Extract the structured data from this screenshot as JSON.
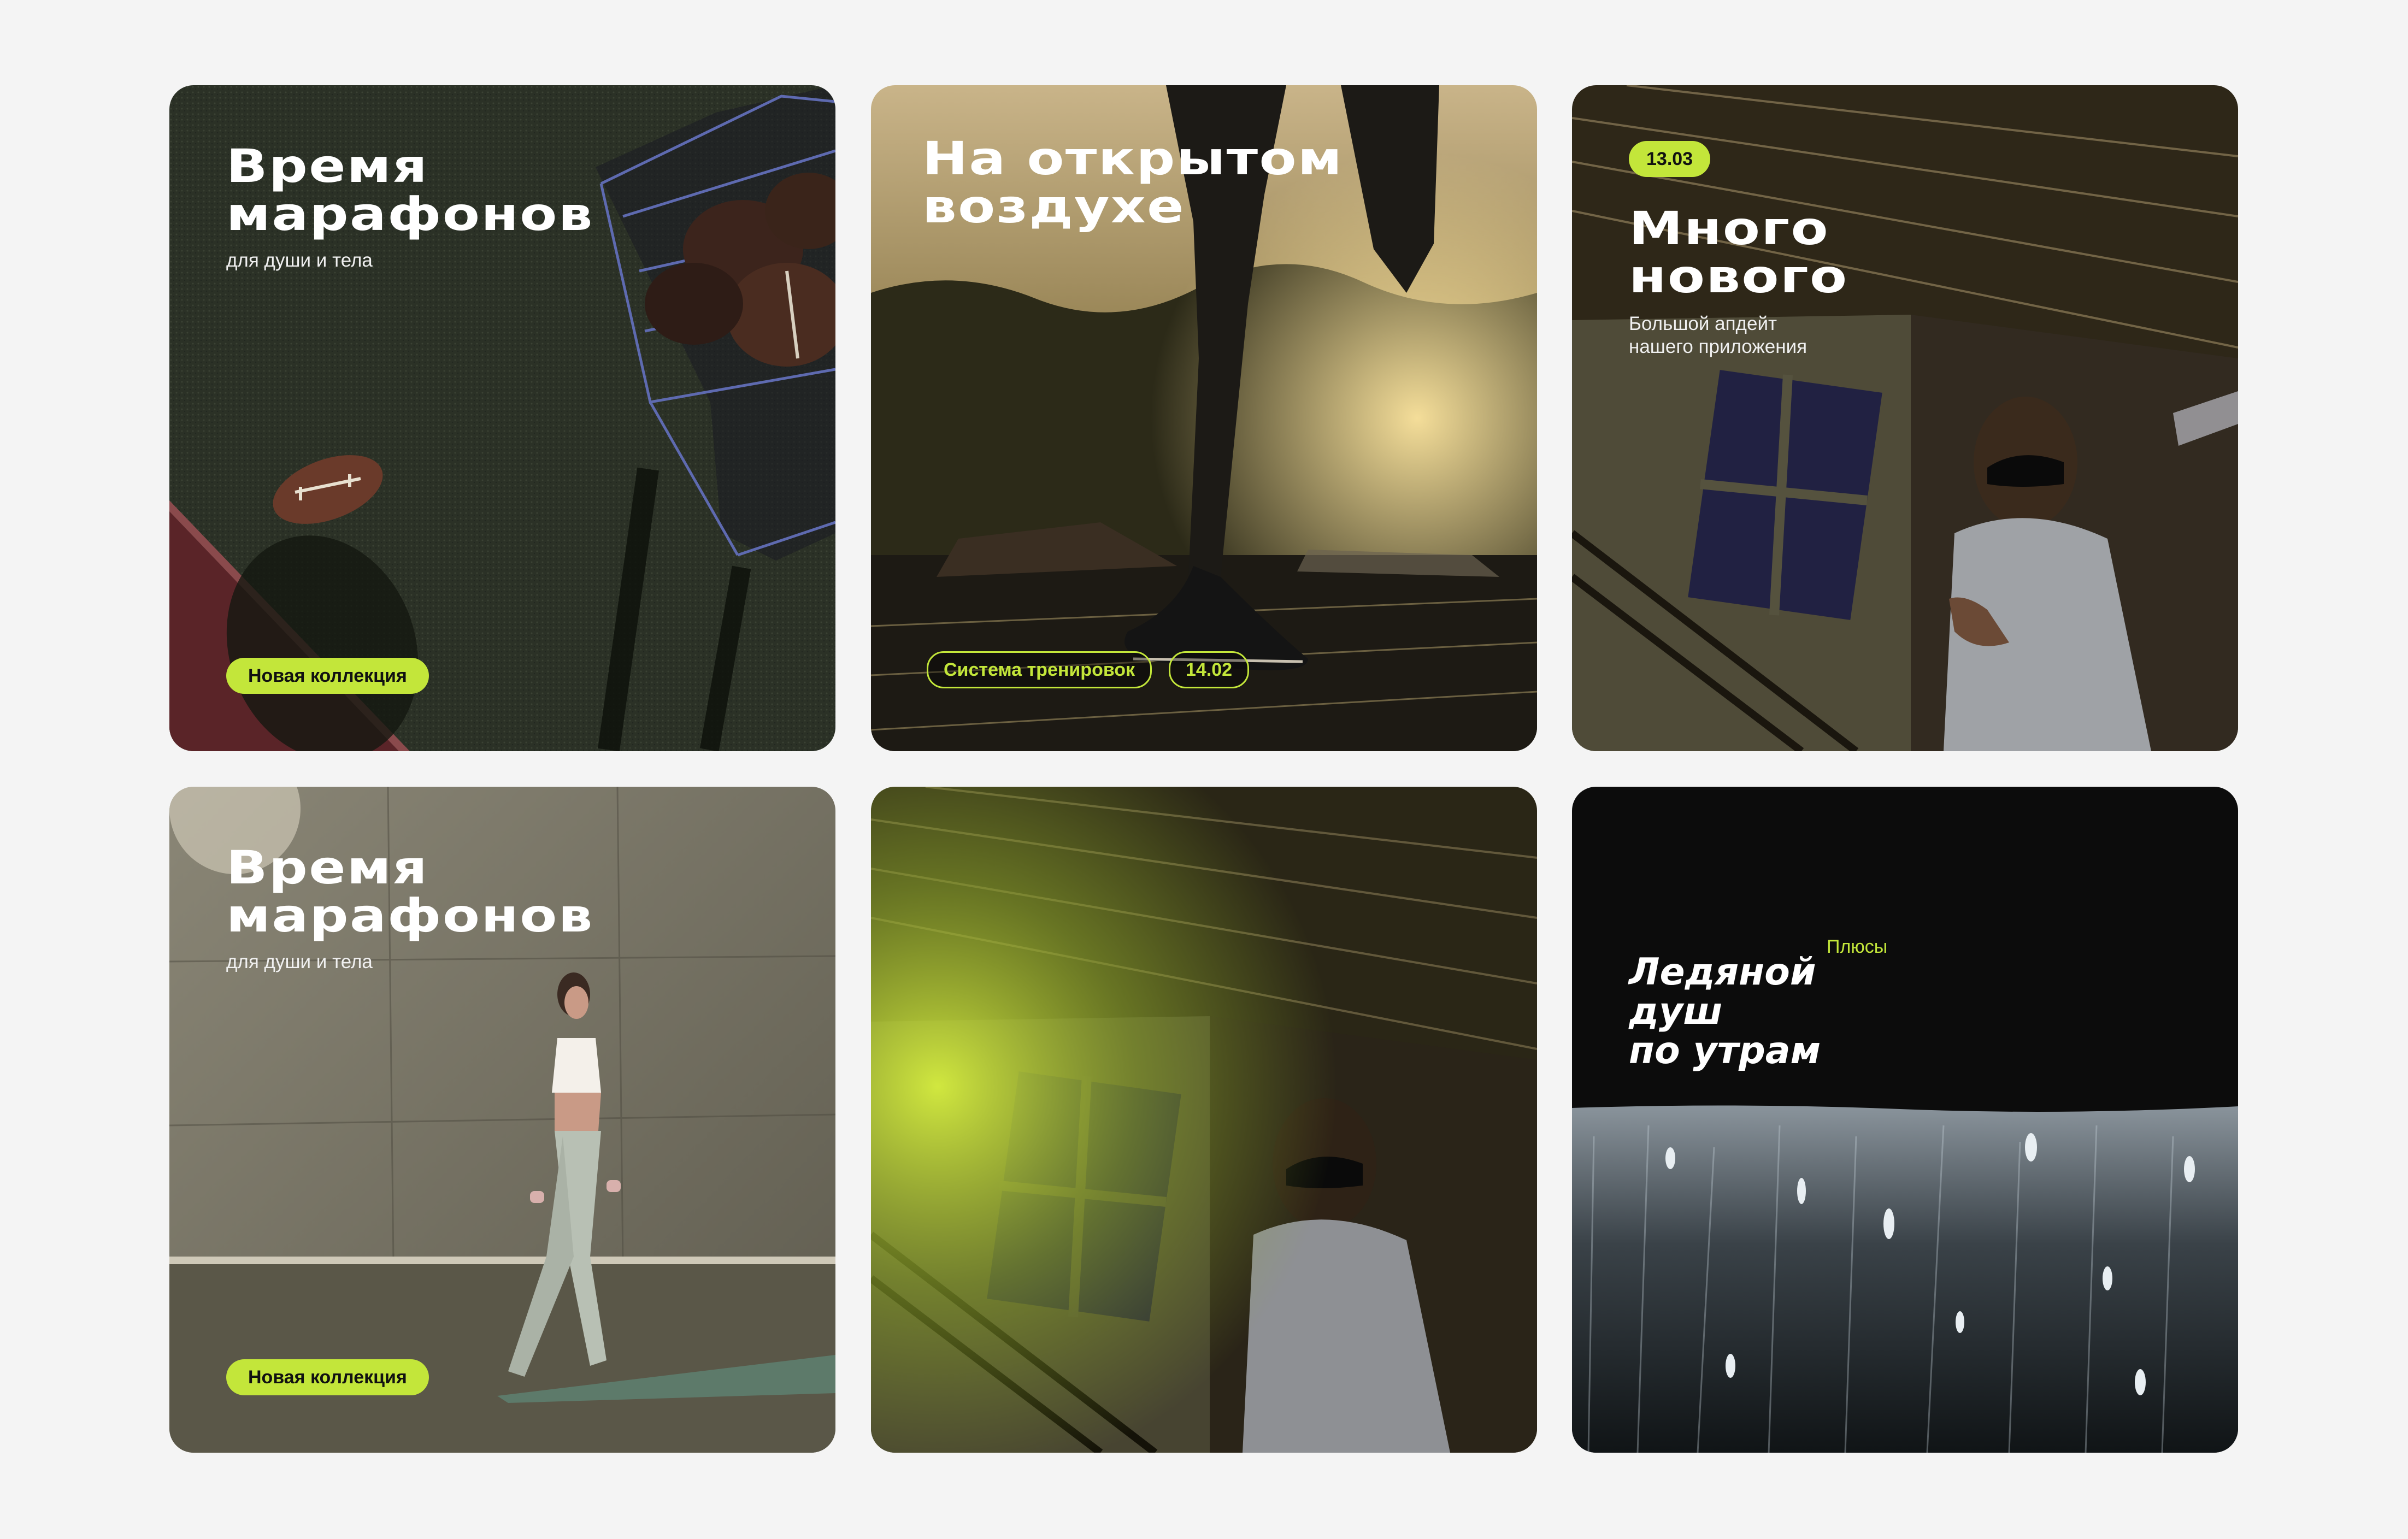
{
  "cards": [
    {
      "title": "Время\nмарафонов",
      "subtitle": "для души и тела",
      "badge": "Новая коллекция"
    },
    {
      "title": "На открытом\nвоздухе",
      "tags": [
        "Система тренировок",
        "14.02"
      ]
    },
    {
      "date": "13.03",
      "title": "Много\nнового",
      "subtitle": "Большой апдейт\nнашего приложения"
    },
    {
      "title": "Время\nмарафонов",
      "subtitle": "для души и тела",
      "badge": "Новая коллекция"
    },
    {},
    {
      "label": "Плюсы",
      "title": "Ледяной\nдуш\nпо утрам"
    }
  ],
  "colors": {
    "page_background": "#f4f4f4",
    "accent": "#c3e63a",
    "text_light": "#ffffff"
  }
}
